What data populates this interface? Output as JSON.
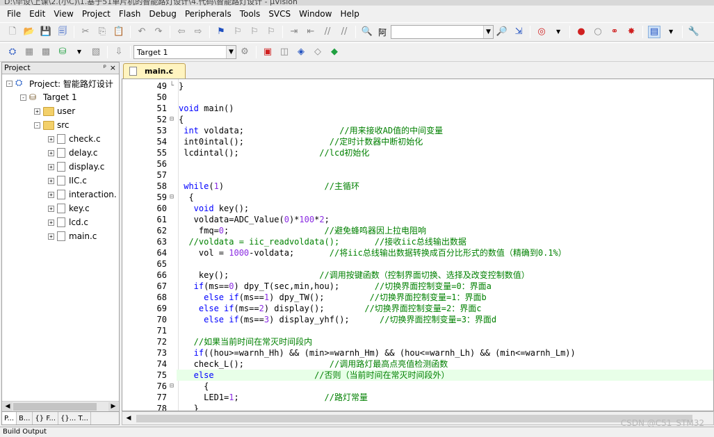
{
  "title_bar": {
    "text": "D:\\毕设\\上课\\2.(小C)\\1.基于51单片机的智能路灯设计\\4.代码\\智能路灯设计 - µVision"
  },
  "menu": [
    "File",
    "Edit",
    "View",
    "Project",
    "Flash",
    "Debug",
    "Peripherals",
    "Tools",
    "SVCS",
    "Window",
    "Help"
  ],
  "toolbar1": {
    "find_text": "阿"
  },
  "toolbar2": {
    "target_select": "Target 1"
  },
  "project_panel": {
    "title": "Project",
    "pin": "ᵖ",
    "close": "×",
    "tree": [
      {
        "label": "Project: 智能路灯设计",
        "level": 0,
        "expander": "-"
      },
      {
        "label": "Target 1",
        "level": 1,
        "expander": "-"
      },
      {
        "label": "user",
        "level": 2,
        "expander": "+"
      },
      {
        "label": "src",
        "level": 2,
        "expander": "-"
      },
      {
        "label": "check.c",
        "level": 3,
        "expander": "+"
      },
      {
        "label": "delay.c",
        "level": 3,
        "expander": "+"
      },
      {
        "label": "display.c",
        "level": 3,
        "expander": "+"
      },
      {
        "label": "IIC.c",
        "level": 3,
        "expander": "+"
      },
      {
        "label": "interaction.",
        "level": 3,
        "expander": "+"
      },
      {
        "label": "key.c",
        "level": 3,
        "expander": "+"
      },
      {
        "label": "lcd.c",
        "level": 3,
        "expander": "+"
      },
      {
        "label": "main.c",
        "level": 3,
        "expander": "+"
      }
    ],
    "tabs": [
      "P...",
      "B...",
      "{} F...",
      "{}... T..."
    ]
  },
  "editor": {
    "tab": "main.c",
    "highlighted_line": 75,
    "lines": [
      {
        "n": 49,
        "fold": "└",
        "code": [
          [
            "",
            "}"
          ]
        ]
      },
      {
        "n": 50,
        "fold": "",
        "code": []
      },
      {
        "n": 51,
        "fold": "",
        "code": [
          [
            "kw",
            "void"
          ],
          [
            "",
            " main()"
          ]
        ]
      },
      {
        "n": 52,
        "fold": "⊟",
        "code": [
          [
            "",
            "{"
          ]
        ]
      },
      {
        "n": 53,
        "fold": "",
        "code": [
          [
            "",
            ""
          ],
          [
            "kw",
            " int"
          ],
          [
            "",
            " voldata;                   "
          ],
          [
            "cm",
            "//用来接收AD值的中间变量"
          ]
        ]
      },
      {
        "n": 54,
        "fold": "",
        "code": [
          [
            "",
            ""
          ],
          [
            "",
            " int0intal();                 "
          ],
          [
            "cm",
            "//定时计数器中断初始化"
          ]
        ]
      },
      {
        "n": 55,
        "fold": "",
        "code": [
          [
            "",
            ""
          ],
          [
            "",
            " lcdintal();                "
          ],
          [
            "cm",
            "//lcd初始化"
          ]
        ]
      },
      {
        "n": 56,
        "fold": "",
        "code": []
      },
      {
        "n": 57,
        "fold": "",
        "code": []
      },
      {
        "n": 58,
        "fold": "",
        "code": [
          [
            "kw",
            " while"
          ],
          [
            "",
            "("
          ],
          [
            "num",
            "1"
          ],
          [
            "",
            ")                    "
          ],
          [
            "cm",
            "//主循环"
          ]
        ]
      },
      {
        "n": 59,
        "fold": "⊟",
        "code": [
          [
            "",
            "  {"
          ]
        ]
      },
      {
        "n": 60,
        "fold": "",
        "code": [
          [
            "kw",
            "   void"
          ],
          [
            "",
            " key();"
          ]
        ]
      },
      {
        "n": 61,
        "fold": "",
        "code": [
          [
            "",
            "   voldata=ADC_Value("
          ],
          [
            "num",
            "0"
          ],
          [
            "",
            ")*"
          ],
          [
            "num",
            "100"
          ],
          [
            "",
            "*"
          ],
          [
            "num",
            "2"
          ],
          [
            "",
            ";"
          ]
        ]
      },
      {
        "n": 62,
        "fold": "",
        "code": [
          [
            "",
            "    fmq="
          ],
          [
            "num",
            "0"
          ],
          [
            "",
            ";                   "
          ],
          [
            "cm",
            "//避免蜂鸣器因上拉电阻响"
          ]
        ]
      },
      {
        "n": 63,
        "fold": "",
        "code": [
          [
            "cm",
            "  //voldata = iic_readvoldata();       //接收iic总线输出数据"
          ]
        ]
      },
      {
        "n": 64,
        "fold": "",
        "code": [
          [
            "",
            "    vol = "
          ],
          [
            "num",
            "1000"
          ],
          [
            "",
            "-voldata;       "
          ],
          [
            "cm",
            "//将iic总线输出数据转换成百分比形式的数值（精确到0.1%）"
          ]
        ]
      },
      {
        "n": 65,
        "fold": "",
        "code": []
      },
      {
        "n": 66,
        "fold": "",
        "code": [
          [
            "",
            "    key();                  "
          ],
          [
            "cm",
            "//调用按键函数（控制界面切换、选择及改变控制数值）"
          ]
        ]
      },
      {
        "n": 67,
        "fold": "",
        "code": [
          [
            "kw",
            "   if"
          ],
          [
            "",
            "(ms=="
          ],
          [
            "num",
            "0"
          ],
          [
            "",
            ") dpy_T(sec,min,hou);       "
          ],
          [
            "cm",
            "//切换界面控制变量=0：界面a"
          ]
        ]
      },
      {
        "n": 68,
        "fold": "",
        "code": [
          [
            "kw",
            "     else if"
          ],
          [
            "",
            "(ms=="
          ],
          [
            "num",
            "1"
          ],
          [
            "",
            ") dpy_TW();         "
          ],
          [
            "cm",
            "//切换界面控制变量=1：界面b"
          ]
        ]
      },
      {
        "n": 69,
        "fold": "",
        "code": [
          [
            "kw",
            "    else if"
          ],
          [
            "",
            "(ms=="
          ],
          [
            "num",
            "2"
          ],
          [
            "",
            ") display();        "
          ],
          [
            "cm",
            "//切换界面控制变量=2：界面c"
          ]
        ]
      },
      {
        "n": 70,
        "fold": "",
        "code": [
          [
            "kw",
            "     else if"
          ],
          [
            "",
            "(ms=="
          ],
          [
            "num",
            "3"
          ],
          [
            "",
            ") display_yhf();      "
          ],
          [
            "cm",
            "//切换界面控制变量=3：界面d"
          ]
        ]
      },
      {
        "n": 71,
        "fold": "",
        "code": []
      },
      {
        "n": 72,
        "fold": "",
        "code": [
          [
            "cm",
            "   //如果当前时间在常灭时间段内"
          ]
        ]
      },
      {
        "n": 73,
        "fold": "",
        "code": [
          [
            "kw",
            "   if"
          ],
          [
            "",
            "((hou>=warnh_Hh) && (min>=warnh_Hm) && (hou<=warnh_Lh) && (min<=warnh_Lm))"
          ]
        ]
      },
      {
        "n": 74,
        "fold": "",
        "code": [
          [
            "",
            "   check_L();                 "
          ],
          [
            "cm",
            "//调用路灯最高点亮值检测函数"
          ]
        ]
      },
      {
        "n": 75,
        "fold": "",
        "code": [
          [
            "kw",
            "   else"
          ],
          [
            "",
            "                    "
          ],
          [
            "cm",
            "//否则（当前时间在常灭时间段外）"
          ]
        ]
      },
      {
        "n": 76,
        "fold": "⊟",
        "code": [
          [
            "",
            "     {"
          ]
        ]
      },
      {
        "n": 77,
        "fold": "",
        "code": [
          [
            "",
            "     LED1="
          ],
          [
            "num",
            "1"
          ],
          [
            "",
            ";                 "
          ],
          [
            "cm",
            "//路灯常量"
          ]
        ]
      },
      {
        "n": 78,
        "fold": "",
        "code": [
          [
            "",
            "   }"
          ]
        ]
      }
    ]
  },
  "bottom_bar": {
    "label": "Build Output"
  },
  "watermark": "CSDN @C51_STM32"
}
